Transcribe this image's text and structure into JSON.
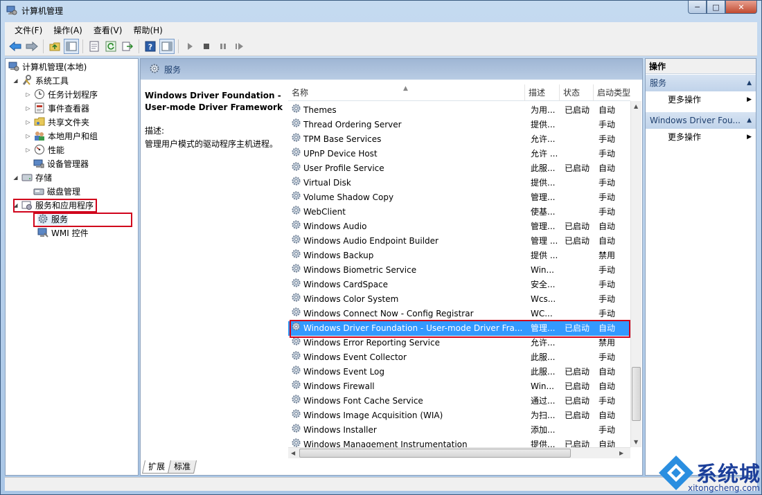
{
  "window": {
    "title": "计算机管理",
    "controls": [
      "─",
      "□",
      "✕"
    ]
  },
  "menu": [
    "文件(F)",
    "操作(A)",
    "查看(V)",
    "帮助(H)"
  ],
  "tree": {
    "root": "计算机管理(本地)",
    "items": [
      {
        "label": "系统工具",
        "icon": "tools-icon"
      },
      {
        "label": "任务计划程序",
        "icon": "clock-icon"
      },
      {
        "label": "事件查看器",
        "icon": "event-viewer-icon"
      },
      {
        "label": "共享文件夹",
        "icon": "shared-folder-icon"
      },
      {
        "label": "本地用户和组",
        "icon": "users-icon"
      },
      {
        "label": "性能",
        "icon": "performance-icon"
      },
      {
        "label": "设备管理器",
        "icon": "device-manager-icon"
      },
      {
        "label": "存储",
        "icon": "storage-icon"
      },
      {
        "label": "磁盘管理",
        "icon": "disk-icon"
      },
      {
        "label": "服务和应用程序",
        "icon": "services-apps-icon"
      },
      {
        "label": "服务",
        "icon": "gear-icon"
      },
      {
        "label": "WMI 控件",
        "icon": "wmi-icon"
      }
    ]
  },
  "main": {
    "header": "服务",
    "description": {
      "title": "Windows Driver Foundation - User-mode Driver Framework",
      "label": "描述:",
      "text": "管理用户模式的驱动程序主机进程。"
    },
    "columns": [
      "名称",
      "描述",
      "状态",
      "启动类型"
    ],
    "rows": [
      {
        "name": "Themes",
        "desc": "为用...",
        "status": "已启动",
        "startup": "自动"
      },
      {
        "name": "Thread Ordering Server",
        "desc": "提供...",
        "status": "",
        "startup": "手动"
      },
      {
        "name": "TPM Base Services",
        "desc": "允许...",
        "status": "",
        "startup": "手动"
      },
      {
        "name": "UPnP Device Host",
        "desc": "允许 ...",
        "status": "",
        "startup": "手动"
      },
      {
        "name": "User Profile Service",
        "desc": "此服...",
        "status": "已启动",
        "startup": "自动"
      },
      {
        "name": "Virtual Disk",
        "desc": "提供...",
        "status": "",
        "startup": "手动"
      },
      {
        "name": "Volume Shadow Copy",
        "desc": "管理...",
        "status": "",
        "startup": "手动"
      },
      {
        "name": "WebClient",
        "desc": "使基...",
        "status": "",
        "startup": "手动"
      },
      {
        "name": "Windows Audio",
        "desc": "管理...",
        "status": "已启动",
        "startup": "自动"
      },
      {
        "name": "Windows Audio Endpoint Builder",
        "desc": "管理 ...",
        "status": "已启动",
        "startup": "自动"
      },
      {
        "name": "Windows Backup",
        "desc": "提供 ...",
        "status": "",
        "startup": "禁用"
      },
      {
        "name": "Windows Biometric Service",
        "desc": "Win...",
        "status": "",
        "startup": "手动"
      },
      {
        "name": "Windows CardSpace",
        "desc": "安全...",
        "status": "",
        "startup": "手动"
      },
      {
        "name": "Windows Color System",
        "desc": "Wcs...",
        "status": "",
        "startup": "手动"
      },
      {
        "name": "Windows Connect Now - Config Registrar",
        "desc": "WC...",
        "status": "",
        "startup": "手动"
      },
      {
        "name": "Windows Driver Foundation - User-mode Driver Fra...",
        "desc": "管理...",
        "status": "已启动",
        "startup": "自动"
      },
      {
        "name": "Windows Error Reporting Service",
        "desc": "允许...",
        "status": "",
        "startup": "禁用"
      },
      {
        "name": "Windows Event Collector",
        "desc": "此服...",
        "status": "",
        "startup": "手动"
      },
      {
        "name": "Windows Event Log",
        "desc": "此服...",
        "status": "已启动",
        "startup": "自动"
      },
      {
        "name": "Windows Firewall",
        "desc": "Win...",
        "status": "已启动",
        "startup": "自动"
      },
      {
        "name": "Windows Font Cache Service",
        "desc": "通过...",
        "status": "已启动",
        "startup": "手动"
      },
      {
        "name": "Windows Image Acquisition (WIA)",
        "desc": "为扫...",
        "status": "已启动",
        "startup": "自动"
      },
      {
        "name": "Windows Installer",
        "desc": "添加...",
        "status": "",
        "startup": "手动"
      },
      {
        "name": "Windows Management Instrumentation",
        "desc": "提供...",
        "status": "已启动",
        "startup": "自动"
      }
    ],
    "tabs": [
      "扩展",
      "标准"
    ]
  },
  "actions": {
    "header": "操作",
    "section1": "服务",
    "more1": "更多操作",
    "section2": "Windows Driver Fou...",
    "more2": "更多操作"
  },
  "watermark": {
    "text": "系统城",
    "url": "xitongcheng.com"
  },
  "colors": {
    "selection": "#3399ff",
    "highlight_box": "#d0021b",
    "pane_header": "#9fb6d4"
  }
}
